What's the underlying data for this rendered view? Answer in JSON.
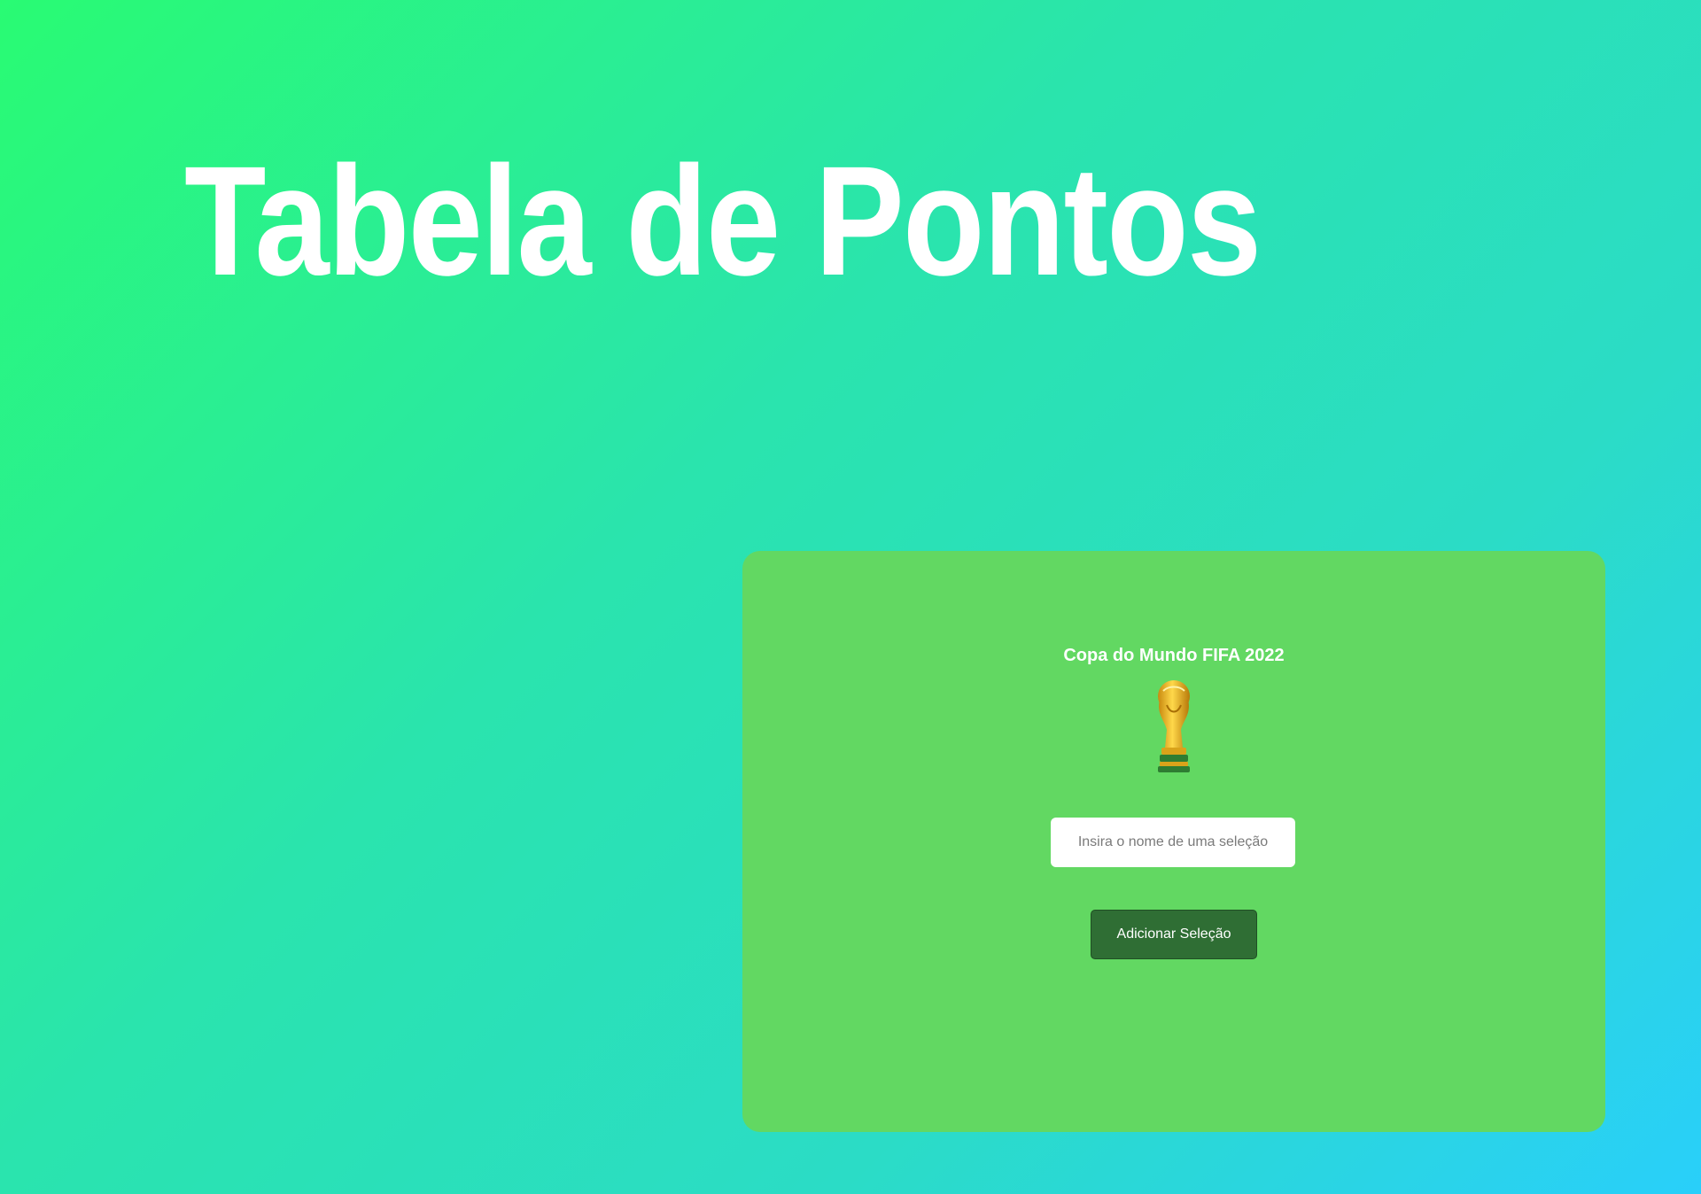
{
  "page": {
    "title": "Tabela de Pontos"
  },
  "card": {
    "title": "Copa do Mundo FIFA 2022",
    "icon": "trophy-icon",
    "input": {
      "value": "",
      "placeholder": "Insira o nome de uma seleção"
    },
    "button_label": "Adicionar Seleção"
  },
  "colors": {
    "background_gradient_start": "#29fb73",
    "background_gradient_end": "#29cffa",
    "card_background": "#62d862",
    "button_background": "#2f6e34",
    "trophy_gold": "#f2b51d",
    "trophy_green": "#2e7d32"
  }
}
